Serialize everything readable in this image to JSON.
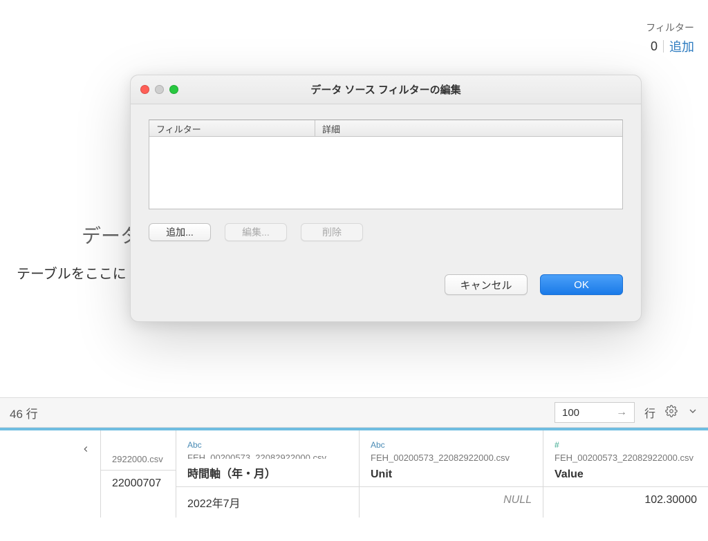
{
  "topRight": {
    "filterLabel": "フィルター",
    "count": "0",
    "addLink": "追加"
  },
  "background": {
    "dataLabel": "データ",
    "tableDropHint": "テーブルをここに"
  },
  "dialog": {
    "title": "データ ソース フィルターの編集",
    "columns": {
      "filter": "フィルター",
      "detail": "詳細"
    },
    "buttons": {
      "add": "追加...",
      "edit": "編集...",
      "remove": "削除",
      "cancel": "キャンセル",
      "ok": "OK"
    }
  },
  "dataPane": {
    "rowsLabel": "46 行",
    "rowsInput": "100",
    "rowsSuffix": "行"
  },
  "columns": [
    {
      "type": "",
      "source": "2922000.csv",
      "name": "",
      "value": "22000707"
    },
    {
      "type": "Abc",
      "source": "FEH_00200573_22082922000.csv",
      "name": "時間軸（年・月）",
      "value": "2022年7月"
    },
    {
      "type": "Abc",
      "source": "FEH_00200573_22082922000.csv",
      "name": "Unit",
      "value": "NULL"
    },
    {
      "type": "#",
      "source": "FEH_00200573_22082922000.csv",
      "name": "Value",
      "value": "102.30000"
    }
  ]
}
